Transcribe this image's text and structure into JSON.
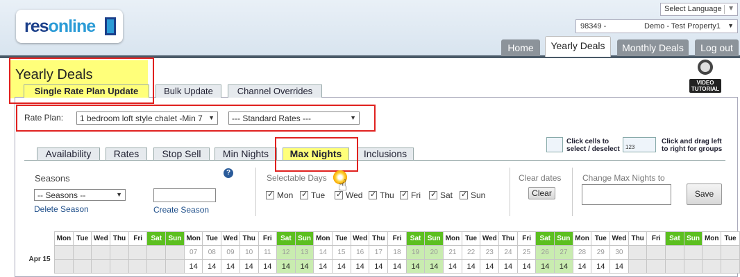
{
  "header": {
    "logo_res": "res",
    "logo_online": "online",
    "language_label": "Select Language",
    "language_arrow": "▼",
    "property_id": "98349 -",
    "property_name": "Demo - Test Property1",
    "property_arrow": "▼",
    "nav": [
      {
        "label": "Home"
      },
      {
        "label": "Yearly Deals"
      },
      {
        "label": "Monthly Deals"
      },
      {
        "label": "Log out"
      }
    ]
  },
  "page": {
    "title": "Yearly Deals",
    "subtabs": [
      {
        "label": "Single Rate Plan Update"
      },
      {
        "label": "Bulk Update"
      },
      {
        "label": "Channel Overrides"
      }
    ],
    "video_label_1": "VIDEO",
    "video_label_2": "TUTORIAL"
  },
  "rate_plan": {
    "label": "Rate Plan:",
    "plan_value": "1 bedroom loft style chalet -Min 7",
    "rate_value": "--- Standard Rates ---"
  },
  "hints": {
    "click_1": "Click cells to",
    "click_2": "select / deselect",
    "drag_1": "Click and drag left",
    "drag_2": "to right for groups",
    "drag_icon_text": "123"
  },
  "tabs": [
    {
      "label": "Availability"
    },
    {
      "label": "Rates"
    },
    {
      "label": "Stop Sell"
    },
    {
      "label": "Min Nights"
    },
    {
      "label": "Max Nights"
    },
    {
      "label": "Inclusions"
    }
  ],
  "seasons": {
    "heading": "Seasons",
    "select_value": "-- Seasons --",
    "delete_link": "Delete Season",
    "create_link": "Create Season",
    "help_symbol": "?"
  },
  "selectable_days": {
    "heading": "Selectable Days",
    "days": [
      "Mon",
      "Tue",
      "Wed",
      "Thu",
      "Fri",
      "Sat",
      "Sun"
    ]
  },
  "clear_dates": {
    "heading": "Clear dates",
    "button": "Clear"
  },
  "change_max": {
    "heading": "Change Max Nights to",
    "value": "",
    "save_button": "Save"
  },
  "calendar": {
    "month_label": "Apr 15",
    "header_days": [
      "Mon",
      "Tue",
      "Wed",
      "Thu",
      "Fri",
      "Sat",
      "Sun",
      "Mon",
      "Tue",
      "Wed",
      "Thu",
      "Fri",
      "Sat",
      "Sun",
      "Mon",
      "Tue",
      "Wed",
      "Thu",
      "Fri",
      "Sat",
      "Sun",
      "Mon",
      "Tue",
      "Wed",
      "Thu",
      "Fri",
      "Sat",
      "Sun",
      "Mon",
      "Tue",
      "Wed",
      "Thu",
      "Fri",
      "Sat",
      "Sun",
      "Mon",
      "Tue"
    ],
    "dates": [
      "",
      "",
      "",
      "",
      "",
      "",
      "",
      "07",
      "08",
      "09",
      "10",
      "11",
      "12",
      "13",
      "14",
      "15",
      "16",
      "17",
      "18",
      "19",
      "20",
      "21",
      "22",
      "23",
      "24",
      "25",
      "26",
      "27",
      "28",
      "29",
      "30",
      "",
      "",
      "",
      "",
      "",
      ""
    ],
    "values": [
      "",
      "",
      "",
      "",
      "",
      "",
      "",
      "14",
      "14",
      "14",
      "14",
      "14",
      "14",
      "14",
      "14",
      "14",
      "14",
      "14",
      "14",
      "14",
      "14",
      "14",
      "14",
      "14",
      "14",
      "14",
      "14",
      "14",
      "14",
      "14",
      "14",
      "",
      "",
      "",
      "",
      "",
      ""
    ]
  }
}
